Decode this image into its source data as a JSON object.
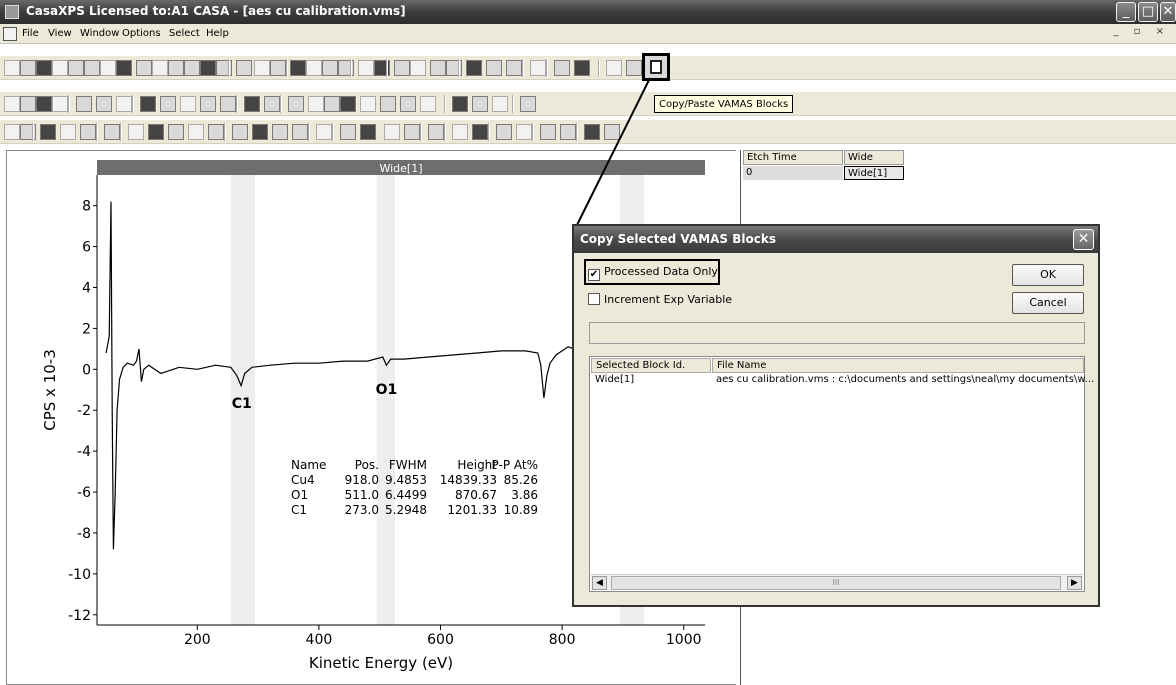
{
  "window": {
    "title": "CasaXPS Licensed to:A1 CASA - [aes cu calibration.vms]",
    "controls": [
      "_",
      "□",
      "✕"
    ]
  },
  "menu": {
    "items": [
      "File",
      "View",
      "Window",
      "Options",
      "Select",
      "Help"
    ],
    "mdi_controls": "_ ▫ ×"
  },
  "tooltip": "Copy/Paste VAMAS Blocks",
  "spectrum": {
    "block_title": "Wide[1]",
    "peak_labels": [
      "C1",
      "O1"
    ],
    "quant_table": {
      "headers": [
        "Name",
        "Pos.",
        "FWHM",
        "Height",
        "P-P At%"
      ],
      "rows": [
        [
          "Cu4",
          "918.0",
          "9.4853",
          "14839.33",
          "85.26"
        ],
        [
          "O1",
          "511.0",
          "6.4499",
          "870.67",
          "3.86"
        ],
        [
          "C1",
          "273.0",
          "5.2948",
          "1201.33",
          "10.89"
        ]
      ]
    }
  },
  "chart_data": {
    "type": "line",
    "xlabel": "Kinetic Energy (eV)",
    "ylabel": "CPS x 10-3",
    "xlim": [
      35,
      1035
    ],
    "ylim": [
      -12.5,
      9.5
    ],
    "xticks": [
      200,
      400,
      600,
      800,
      1000
    ],
    "yticks": [
      8,
      6,
      4,
      2,
      0,
      -2,
      -4,
      -6,
      -8,
      -10,
      -12
    ],
    "regions": [
      [
        255,
        295
      ],
      [
        495,
        525
      ],
      [
        895,
        935
      ]
    ],
    "series": [
      {
        "x": [
          50,
          55,
          58,
          60,
          62,
          65,
          68,
          72,
          78,
          85,
          95,
          100,
          104,
          108,
          112,
          120,
          140,
          170,
          200,
          230,
          255,
          265,
          272,
          278,
          290,
          320,
          360,
          400,
          440,
          480,
          505,
          511,
          518,
          540,
          580,
          620,
          660,
          700,
          740,
          760,
          765,
          770,
          775,
          780,
          790,
          800,
          810,
          820
        ],
        "y": [
          0.8,
          1.6,
          8.2,
          -2.0,
          -8.8,
          -6.0,
          -2.0,
          -0.5,
          0.1,
          0.3,
          0.2,
          0.4,
          1.0,
          -0.6,
          0.0,
          0.2,
          -0.2,
          0.1,
          0.0,
          0.2,
          0.1,
          -0.3,
          -0.8,
          -0.2,
          0.1,
          0.2,
          0.3,
          0.3,
          0.4,
          0.4,
          0.6,
          0.2,
          0.5,
          0.5,
          0.6,
          0.7,
          0.8,
          0.9,
          0.9,
          0.8,
          0.2,
          -1.4,
          -0.3,
          0.3,
          0.7,
          0.9,
          1.1,
          1.0
        ]
      }
    ]
  },
  "browser": {
    "headers": [
      "Etch Time",
      "Wide"
    ],
    "row": [
      "0",
      "Wide[1]"
    ]
  },
  "dialog": {
    "title": "Copy Selected VAMAS Blocks",
    "processed_label": "Processed Data Only",
    "processed_checked": "✔",
    "increment_label": "Increment Exp Variable",
    "ok_label": "OK",
    "cancel_label": "Cancel",
    "list_headers": [
      "Selected Block Id.",
      "File Name"
    ],
    "list_row": [
      "Wide[1]",
      "aes cu calibration.vms : c:\\documents and settings\\neal\\my documents\\w..."
    ],
    "scroll_grip": "III"
  }
}
